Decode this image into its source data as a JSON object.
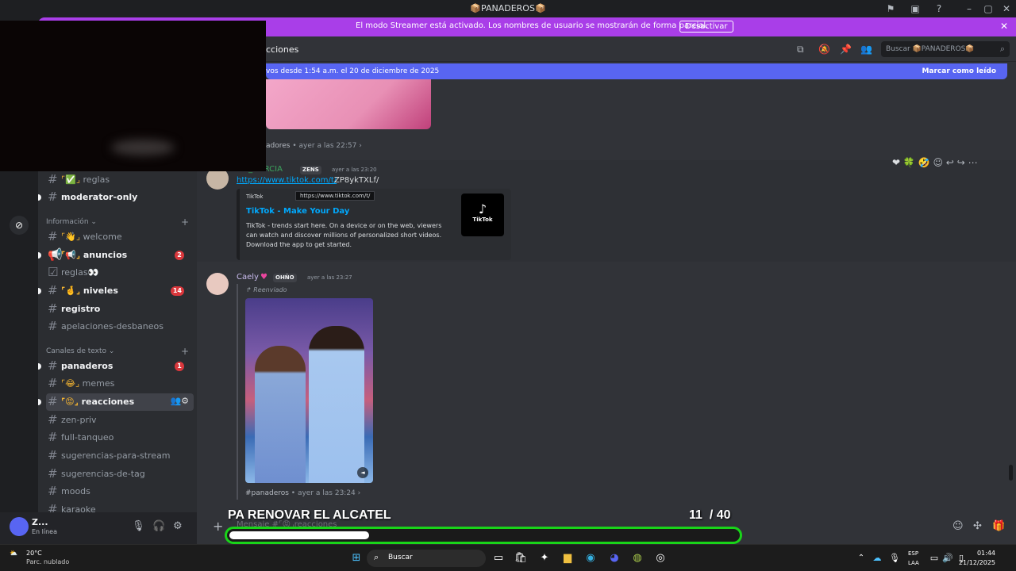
{
  "window": {
    "title": "📦PANADEROS📦"
  },
  "banner": {
    "text": "El modo Streamer está activado. Los nombres de usuario se mostrarán de forma parcial.",
    "button": "Desactivar"
  },
  "header": {
    "channel_fragment": "cciones",
    "search_placeholder": "Buscar 📦PANADEROS📦"
  },
  "new_messages": {
    "text": "vos desde 1:54 a.m. el 20 de diciembre de 2025",
    "action": "Marcar como leído"
  },
  "sidebar": {
    "channels_top": [
      {
        "icon": "⌜✅⌟",
        "name": "reglas",
        "unread": false
      },
      {
        "icon": "",
        "name": "moderator-only",
        "unread": true
      }
    ],
    "cat_info": "Información",
    "channels_info": [
      {
        "icon": "⌜👋⌟",
        "name": "welcome",
        "unread": false,
        "badge": ""
      },
      {
        "icon": "⌜📢⌟",
        "name": "anuncios",
        "unread": true,
        "badge": "2"
      },
      {
        "icon": "",
        "name": "reglas👀",
        "unread": false,
        "badge": ""
      },
      {
        "icon": "⌜🤞⌟",
        "name": "niveles",
        "unread": true,
        "badge": "14"
      },
      {
        "icon": "",
        "name": "registro",
        "unread": true,
        "badge": ""
      },
      {
        "icon": "",
        "name": "apelaciones-desbaneos",
        "unread": false,
        "badge": ""
      }
    ],
    "cat_text": "Canales de texto",
    "channels_text": [
      {
        "icon": "",
        "name": "panaderos",
        "unread": true,
        "badge": "1"
      },
      {
        "icon": "⌜😂⌟",
        "name": "memes",
        "unread": false,
        "badge": ""
      },
      {
        "icon": "⌜😡⌟",
        "name": "reacciones",
        "unread": true,
        "badge": ""
      },
      {
        "icon": "",
        "name": "zen-priv",
        "unread": false,
        "badge": ""
      },
      {
        "icon": "",
        "name": "full-tanqueo",
        "unread": false,
        "badge": ""
      },
      {
        "icon": "",
        "name": "sugerencias-para-stream",
        "unread": false,
        "badge": ""
      },
      {
        "icon": "",
        "name": "sugerencias-de-tag",
        "unread": false,
        "badge": ""
      },
      {
        "icon": "",
        "name": "moods",
        "unread": false,
        "badge": ""
      },
      {
        "icon": "",
        "name": "karaoke",
        "unread": false,
        "badge": ""
      }
    ]
  },
  "user": {
    "name": "Z...",
    "status": "En línea"
  },
  "messages": {
    "prev_meta": {
      "channel": "adores",
      "time": "ayer a las 22:57"
    },
    "m1": {
      "author": "...L_GARCIA",
      "tag": "ZENS",
      "time": "ayer a las 23:20",
      "link": "https://www.tiktok.com/t/",
      "link_rest": "ZP8ykTXLf/",
      "tooltip": "https://www.tiktok.com/t/",
      "embed": {
        "provider": "TikTok",
        "title": "TikTok - Make Your Day",
        "description": "TikTok - trends start here. On a device or on the web, viewers can watch and discover millions of personalized short videos. Download the app to get started.",
        "thumb_label": "TikTok"
      }
    },
    "m2": {
      "author": "Caely",
      "tag": "OHÑO",
      "time": "ayer a las 23:27",
      "forwarded": "Reenviado",
      "meta_channel": "#panaderos",
      "meta_time": "ayer a las 23:24"
    }
  },
  "input": {
    "ghost": "Mensaje #⌜😡⌟reacciones"
  },
  "overlay": {
    "title": "PA RENOVAR EL ALCATEL",
    "count": "11",
    "total": "/ 40",
    "progress_fraction": 0.275,
    "bar_color": "#19d419"
  },
  "taskbar": {
    "temp": "20°C",
    "condition": "Parc. nublado",
    "search": "Buscar",
    "lang1": "ESP",
    "lang2": "LAA",
    "time": "01:44",
    "date": "21/12/2025"
  }
}
